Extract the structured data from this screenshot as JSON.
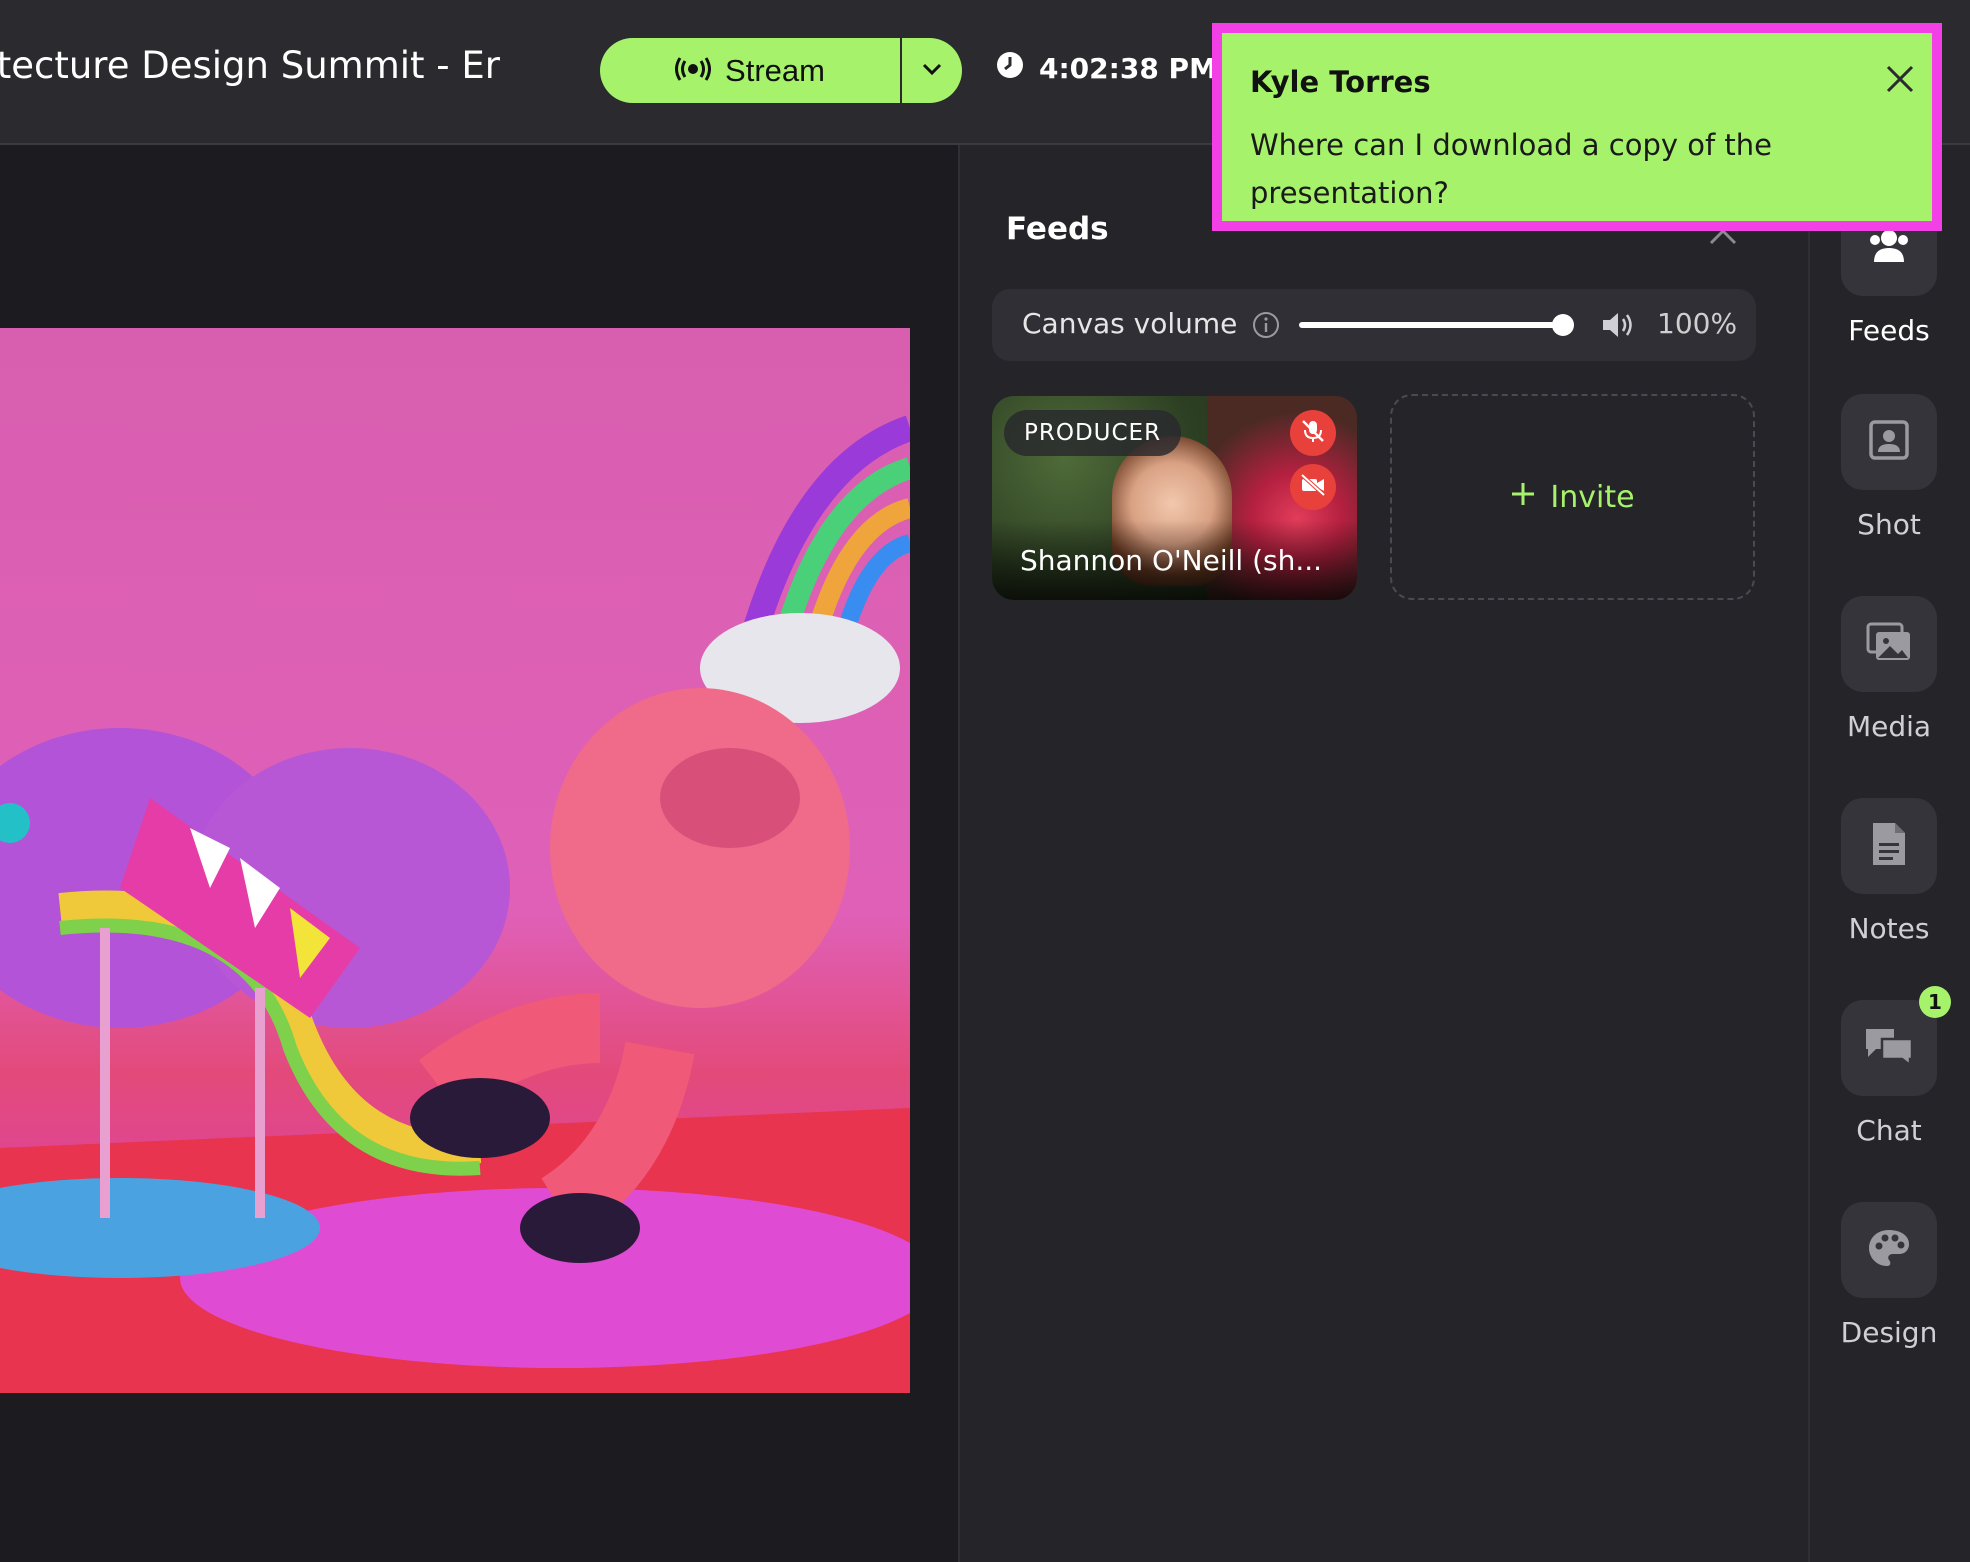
{
  "header": {
    "event_title": "itecture Design Summit - Er",
    "stream_label": "Stream",
    "clock_time": "4:02:38 PM"
  },
  "toast": {
    "sender": "Kyle Torres",
    "message": "Where can I download a copy of the presentation?"
  },
  "panel": {
    "title": "Feeds",
    "volume_label": "Canvas volume",
    "volume_percent": "100%",
    "volume_value": 100
  },
  "feed": {
    "role": "PRODUCER",
    "name": "Shannon O'Neill (sh..."
  },
  "invite": {
    "label": "Invite"
  },
  "rail": {
    "items": [
      {
        "label": "Feeds",
        "icon": "people-icon"
      },
      {
        "label": "Shot",
        "icon": "portrait-frame-icon"
      },
      {
        "label": "Media",
        "icon": "images-icon"
      },
      {
        "label": "Notes",
        "icon": "document-icon"
      },
      {
        "label": "Chat",
        "icon": "chat-bubbles-icon",
        "badge": "1"
      },
      {
        "label": "Design",
        "icon": "palette-icon"
      }
    ]
  },
  "colors": {
    "accent": "#a6f36b",
    "highlight_border": "#f33fe6",
    "danger": "#e8413b",
    "background": "#1c1c20"
  }
}
